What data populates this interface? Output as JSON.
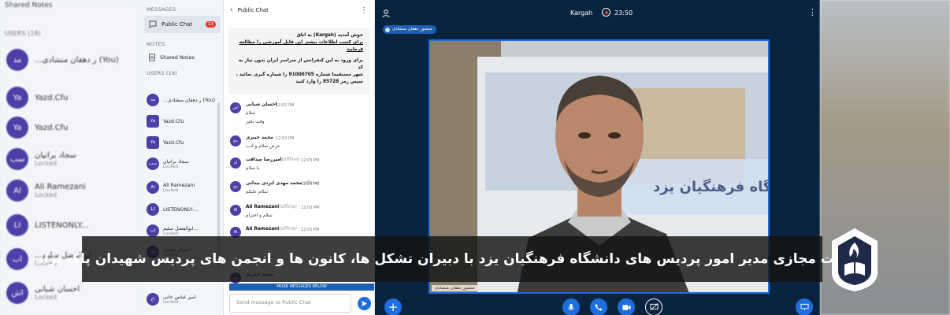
{
  "bg_left": {
    "shared_notes": "Shared Notes",
    "users_header": "USERS (18)",
    "rows": [
      {
        "initials": "مد",
        "name": "...ر دهقان منشادی (You)",
        "sub": ""
      },
      {
        "initials": "Ya",
        "name": "Yazd.Cfu",
        "sub": ""
      },
      {
        "initials": "Ya",
        "name": "Yazd.Cfu",
        "sub": ""
      },
      {
        "initials": "سب",
        "name": "سجاد براتیان",
        "sub": "Locked"
      },
      {
        "initials": "Al",
        "name": "Ali Ramezani",
        "sub": "Locked"
      },
      {
        "initials": "LI",
        "name": "LISTENONLY...",
        "sub": ""
      },
      {
        "initials": "اب",
        "name": "...ابوالفضل سلیم",
        "sub": "Locked"
      },
      {
        "initials": "اش",
        "name": "احسان شبانی",
        "sub": "Locked"
      }
    ]
  },
  "user_panel": {
    "messages_title": "MESSAGES",
    "public_chat": "Public Chat",
    "public_chat_badge": "13",
    "notes_title": "NOTES",
    "shared_notes": "Shared Notes",
    "users_title": "USERS (18)",
    "users": [
      {
        "initials": "مد",
        "name": "...ر دهقان منشادی (You)",
        "sub": "",
        "round": true
      },
      {
        "initials": "Ya",
        "name": "Yazd.Cfu",
        "sub": "",
        "round": false
      },
      {
        "initials": "Ya",
        "name": "Yazd.Cfu",
        "sub": "",
        "round": false
      },
      {
        "initials": "سب",
        "name": "سجاد براتیان",
        "sub": "Locked",
        "round": true
      },
      {
        "initials": "Al",
        "name": "Ali Ramezani",
        "sub": "Locked",
        "round": true
      },
      {
        "initials": "LI",
        "name": "LISTENONLY-...",
        "sub": "",
        "round": true
      },
      {
        "initials": "اب",
        "name": "ابوالفضل سلیم...",
        "sub": "Locked",
        "round": true
      },
      {
        "initials": "اش",
        "name": "احسان شبانی",
        "sub": "Locked",
        "round": true
      },
      {
        "initials": "اخ",
        "name": "امیر عباس خانی",
        "sub": "Locked",
        "round": true
      }
    ]
  },
  "chat": {
    "title": "Public Chat",
    "welcome": [
      "خوش آمدید (Kargah) به اتاق",
      "برای کسب اطلاعات بیشتر این فایل آموزشی را مطالعه فرمایید",
      "برای ورود به این کنفرانس از سراسر ایران بدون تیاز به کد",
      "شهر مستقیما شماره 91000705 را شماره گیری نمائید ،",
      "سپس رمز 85728 را وارد کنید"
    ],
    "messages": [
      {
        "initials": "اش",
        "name": "احسان شبانی",
        "offline": "",
        "time": "12:02 PM",
        "lines": [
          "سلام",
          "وقت بخیر"
        ]
      },
      {
        "initials": "مح",
        "name": "محمد خبیری",
        "offline": "",
        "time": "12:03 PM",
        "lines": [
          "عرض سلام و ادب"
        ]
      },
      {
        "initials": "ام",
        "name": "امیررضا صداقت",
        "offline": "(offline)",
        "time": "12:03 PM",
        "lines": [
          "با سلام"
        ]
      },
      {
        "initials": "مح",
        "name": "محمد مهدی ایزدی بیدانی",
        "offline": "(offline)",
        "time": "12:04 PM",
        "lines": [
          "سلام علیکم"
        ]
      },
      {
        "initials": "Al",
        "name": "Ali Ramezani",
        "offline": "(offline)",
        "time": "12:05 PM",
        "lines": [
          "سلام و احترام"
        ]
      },
      {
        "initials": "Al",
        "name": "Ali Ramezani",
        "offline": "(offline)",
        "time": "12:05 PM",
        "lines": [
          ""
        ]
      },
      {
        "initials": "مح",
        "name": "محمد خبیری",
        "offline": "",
        "time": "",
        "lines": []
      }
    ],
    "more_messages": "MORE MESSAGES BELOW",
    "input_placeholder": "Send message to Public Chat"
  },
  "main": {
    "room_name": "Kargah",
    "timer": "23:50",
    "presenter": "منصور دهقان منشادی",
    "video_name": "منصور دهقان منشادی",
    "banner_text": "دانشگاه فرهنگیان یزد"
  },
  "caption": "نشست مجازی مدیر امور پردیس های دانشگاه فرهنگیان یزد با دبیران تشکل ها، کانون ها و انجمن های پردیس شهیدان پاک نژاد",
  "colors": {
    "accent": "#1d6fe0",
    "avatar": "#4d3fa6",
    "dark_bg": "#0a2440"
  }
}
